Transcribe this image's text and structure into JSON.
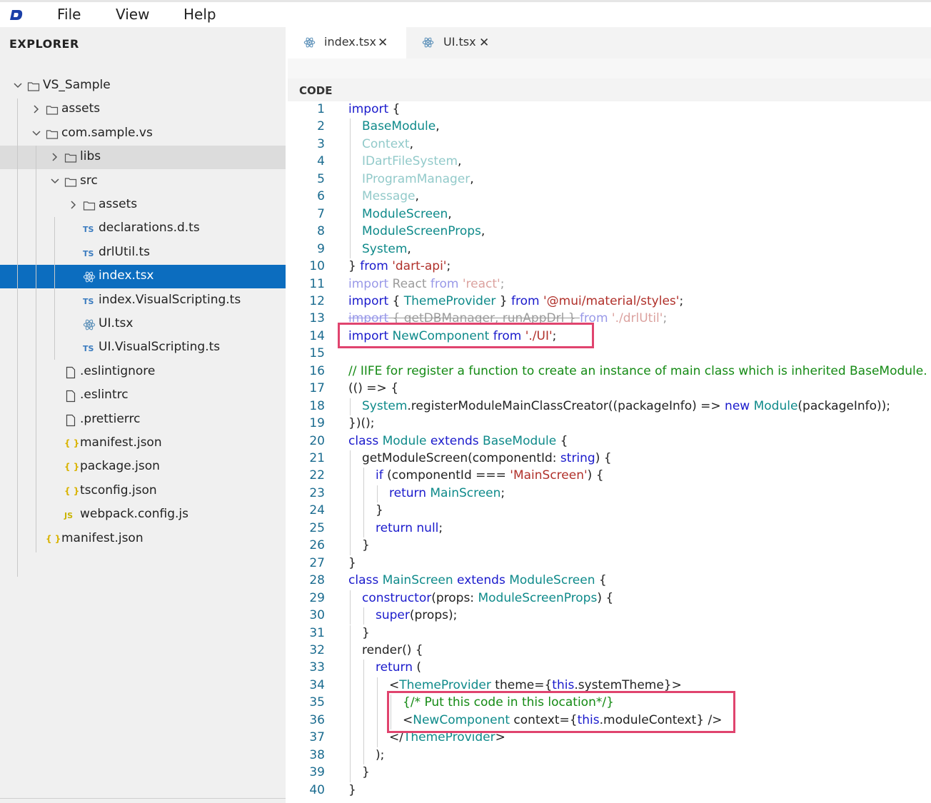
{
  "menubar": {
    "logo": "dart-logo-icon",
    "items": [
      "File",
      "View",
      "Help"
    ]
  },
  "explorer": {
    "title": "EXPLORER",
    "tree": [
      {
        "label": "VS_Sample",
        "type": "folder",
        "open": true,
        "depth": 0
      },
      {
        "label": "assets",
        "type": "folder",
        "open": false,
        "depth": 1
      },
      {
        "label": "com.sample.vs",
        "type": "folder",
        "open": true,
        "depth": 1
      },
      {
        "label": "libs",
        "type": "folder",
        "open": false,
        "depth": 2,
        "hover": true
      },
      {
        "label": "src",
        "type": "folder",
        "open": true,
        "depth": 2
      },
      {
        "label": "assets",
        "type": "folder",
        "open": false,
        "depth": 3
      },
      {
        "label": "declarations.d.ts",
        "type": "ts",
        "depth": 3
      },
      {
        "label": "drlUtil.ts",
        "type": "ts",
        "depth": 3
      },
      {
        "label": "index.tsx",
        "type": "react",
        "depth": 3,
        "selected": true
      },
      {
        "label": "index.VisualScripting.ts",
        "type": "ts",
        "depth": 3
      },
      {
        "label": "UI.tsx",
        "type": "react",
        "depth": 3
      },
      {
        "label": "UI.VisualScripting.ts",
        "type": "ts",
        "depth": 3
      },
      {
        "label": ".eslintignore",
        "type": "file",
        "depth": 2
      },
      {
        "label": ".eslintrc",
        "type": "file",
        "depth": 2
      },
      {
        "label": ".prettierrc",
        "type": "file",
        "depth": 2
      },
      {
        "label": "manifest.json",
        "type": "json",
        "depth": 2
      },
      {
        "label": "package.json",
        "type": "json",
        "depth": 2
      },
      {
        "label": "tsconfig.json",
        "type": "json",
        "depth": 2
      },
      {
        "label": "webpack.config.js",
        "type": "js",
        "depth": 2
      },
      {
        "label": "manifest.json",
        "type": "json",
        "depth": 1
      }
    ]
  },
  "tabs": [
    {
      "label": "index.tsx",
      "active": true,
      "icon": "react-icon",
      "close": "✕"
    },
    {
      "label": "UI.tsx",
      "active": false,
      "icon": "react-icon",
      "close": "✕"
    }
  ],
  "editor": {
    "header": "CODE",
    "lines": [
      [
        [
          "k",
          "import"
        ],
        [
          "p",
          " {"
        ]
      ],
      [
        [
          "t",
          "BaseModule"
        ],
        [
          "p",
          ","
        ]
      ],
      [
        [
          "t dim",
          "Context"
        ],
        [
          "p",
          ","
        ]
      ],
      [
        [
          "t dim",
          "IDartFileSystem"
        ],
        [
          "p",
          ","
        ]
      ],
      [
        [
          "t dim",
          "IProgramManager"
        ],
        [
          "p",
          ","
        ]
      ],
      [
        [
          "t dim",
          "Message"
        ],
        [
          "p",
          ","
        ]
      ],
      [
        [
          "t",
          "ModuleScreen"
        ],
        [
          "p",
          ","
        ]
      ],
      [
        [
          "t",
          "ModuleScreenProps"
        ],
        [
          "p",
          ","
        ]
      ],
      [
        [
          "t",
          "System"
        ],
        [
          "p",
          ","
        ]
      ],
      [
        [
          "p",
          "} "
        ],
        [
          "k",
          "from"
        ],
        [
          "p",
          " "
        ],
        [
          "s",
          "'dart-api'"
        ],
        [
          "p",
          ";"
        ]
      ],
      [
        [
          "k dim",
          "import"
        ],
        [
          "p dim",
          " React "
        ],
        [
          "k dim",
          "from"
        ],
        [
          "p dim",
          " "
        ],
        [
          "s dim",
          "'react'"
        ],
        [
          "p dim",
          ";"
        ]
      ],
      [
        [
          "k",
          "import"
        ],
        [
          "p",
          " { "
        ],
        [
          "t",
          "ThemeProvider"
        ],
        [
          "p",
          " } "
        ],
        [
          "k",
          "from"
        ],
        [
          "p",
          " "
        ],
        [
          "s",
          "'@mui/material/styles'"
        ],
        [
          "p",
          ";"
        ]
      ],
      [
        [
          "k dim strike",
          "import"
        ],
        [
          "p dim strike",
          " { getDBManager, runAppDrl } "
        ],
        [
          "k dim",
          "from"
        ],
        [
          "p dim",
          " "
        ],
        [
          "s dim",
          "'./drlUtil'"
        ],
        [
          "p dim",
          ";"
        ]
      ],
      [
        [
          "k",
          "import"
        ],
        [
          "p",
          " "
        ],
        [
          "t",
          "NewComponent"
        ],
        [
          "p",
          " "
        ],
        [
          "k",
          "from"
        ],
        [
          "p",
          " "
        ],
        [
          "s",
          "'./UI'"
        ],
        [
          "p",
          ";"
        ]
      ],
      [
        [
          "p",
          ""
        ]
      ],
      [
        [
          "c",
          "// IIFE for register a function to create an instance of main class which is inherited BaseModule."
        ]
      ],
      [
        [
          "p",
          "(() => {"
        ]
      ],
      [
        [
          "t",
          "System"
        ],
        [
          "p",
          ".registerModuleMainClassCreator((packageInfo) => "
        ],
        [
          "k",
          "new"
        ],
        [
          "p",
          " "
        ],
        [
          "t",
          "Module"
        ],
        [
          "p",
          "(packageInfo));"
        ]
      ],
      [
        [
          "p",
          "})();"
        ]
      ],
      [
        [
          "k",
          "class"
        ],
        [
          "p",
          " "
        ],
        [
          "t",
          "Module"
        ],
        [
          "p",
          " "
        ],
        [
          "k",
          "extends"
        ],
        [
          "p",
          " "
        ],
        [
          "t",
          "BaseModule"
        ],
        [
          "p",
          " {"
        ]
      ],
      [
        [
          "p",
          "getModuleScreen(componentId: "
        ],
        [
          "k",
          "string"
        ],
        [
          "p",
          ") {"
        ]
      ],
      [
        [
          "k",
          "if"
        ],
        [
          "p",
          " (componentId === "
        ],
        [
          "s",
          "'MainScreen'"
        ],
        [
          "p",
          ") {"
        ]
      ],
      [
        [
          "k",
          "return"
        ],
        [
          "p",
          " "
        ],
        [
          "t",
          "MainScreen"
        ],
        [
          "p",
          ";"
        ]
      ],
      [
        [
          "p",
          "}"
        ]
      ],
      [
        [
          "k",
          "return"
        ],
        [
          "p",
          " "
        ],
        [
          "k",
          "null"
        ],
        [
          "p",
          ";"
        ]
      ],
      [
        [
          "p",
          "}"
        ]
      ],
      [
        [
          "p",
          "}"
        ]
      ],
      [
        [
          "k",
          "class"
        ],
        [
          "p",
          " "
        ],
        [
          "t",
          "MainScreen"
        ],
        [
          "p",
          " "
        ],
        [
          "k",
          "extends"
        ],
        [
          "p",
          " "
        ],
        [
          "t",
          "ModuleScreen"
        ],
        [
          "p",
          " {"
        ]
      ],
      [
        [
          "k",
          "constructor"
        ],
        [
          "p",
          "(props: "
        ],
        [
          "t",
          "ModuleScreenProps"
        ],
        [
          "p",
          ") {"
        ]
      ],
      [
        [
          "k",
          "super"
        ],
        [
          "p",
          "(props);"
        ]
      ],
      [
        [
          "p",
          "}"
        ]
      ],
      [
        [
          "p",
          "render() {"
        ]
      ],
      [
        [
          "k",
          "return"
        ],
        [
          "p",
          " ("
        ]
      ],
      [
        [
          "p",
          "<"
        ],
        [
          "t",
          "ThemeProvider"
        ],
        [
          "p",
          " theme={"
        ],
        [
          "k",
          "this"
        ],
        [
          "p",
          ".systemTheme}>"
        ]
      ],
      [
        [
          "c",
          "{/* Put this code in this location*/}"
        ]
      ],
      [
        [
          "p",
          "<"
        ],
        [
          "t",
          "NewComponent"
        ],
        [
          "p",
          " context={"
        ],
        [
          "k",
          "this"
        ],
        [
          "p",
          ".moduleContext} />"
        ]
      ],
      [
        [
          "p",
          "</"
        ],
        [
          "t",
          "ThemeProvider"
        ],
        [
          "p",
          ">"
        ]
      ],
      [
        [
          "p",
          ");"
        ]
      ],
      [
        [
          "p",
          "}"
        ]
      ],
      [
        [
          "p",
          "}"
        ]
      ]
    ],
    "indent": [
      0,
      1,
      1,
      1,
      1,
      1,
      1,
      1,
      1,
      0,
      0,
      0,
      0,
      0,
      0,
      0,
      0,
      1,
      0,
      0,
      1,
      2,
      3,
      2,
      2,
      1,
      0,
      0,
      1,
      2,
      1,
      1,
      2,
      3,
      4,
      4,
      3,
      2,
      1,
      0
    ]
  }
}
